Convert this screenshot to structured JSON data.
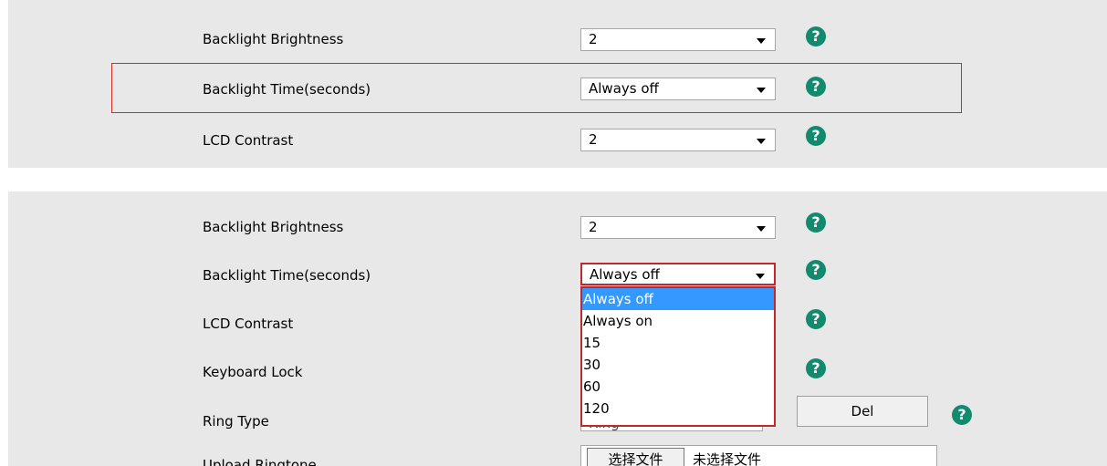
{
  "panel1": {
    "rows": [
      {
        "label": "Backlight Brightness",
        "value": "2"
      },
      {
        "label": "Backlight Time(seconds)",
        "value": "Always off"
      },
      {
        "label": "LCD Contrast",
        "value": "2"
      }
    ]
  },
  "panel2": {
    "rows": [
      {
        "label": "Backlight Brightness",
        "value": "2"
      },
      {
        "label": "Backlight Time(seconds)",
        "value": "Always off"
      },
      {
        "label": "LCD Contrast"
      },
      {
        "label": "Keyboard Lock"
      },
      {
        "label": "Ring Type"
      },
      {
        "label": "Upload Ringtone"
      }
    ],
    "dropdown_options": [
      "Always off",
      "Always on",
      "15",
      "30",
      "60",
      "120"
    ],
    "ring_type_partial": "Ring",
    "del_button": "Del",
    "file_button": "选择文件",
    "file_status": "未选择文件"
  },
  "help_glyph": "?",
  "colors": {
    "panel_bg": "#e8e8e8",
    "highlight_border": "#cf2b2b",
    "help_icon": "#128a6d",
    "selected_option": "#3399ff"
  }
}
